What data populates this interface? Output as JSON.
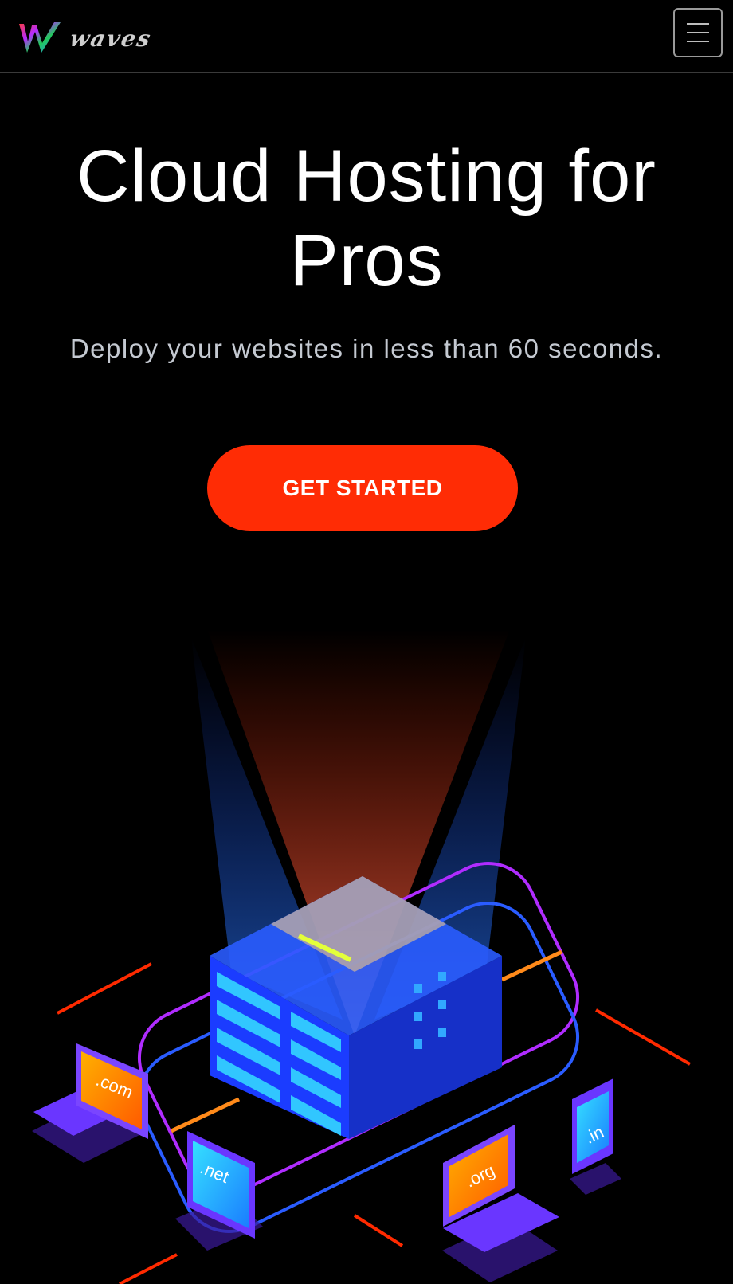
{
  "brand": {
    "logo_letter": "W",
    "logo_wordmark": "waves"
  },
  "nav": {
    "menu_icon": "hamburger-menu-icon"
  },
  "hero": {
    "title": "Cloud Hosting for Pros",
    "subtitle": "Deploy your websites in less than 60 seconds.",
    "cta_label": "GET STARTED"
  },
  "illustration": {
    "domains": [
      ".com",
      ".net",
      ".org",
      ".in"
    ]
  },
  "colors": {
    "background": "#000000",
    "cta": "#ff2c05",
    "subtitle": "#c4c9d1",
    "server_blue": "#1b3cff",
    "device_purple": "#6a36ff",
    "accent_orange": "#ff7a00"
  }
}
